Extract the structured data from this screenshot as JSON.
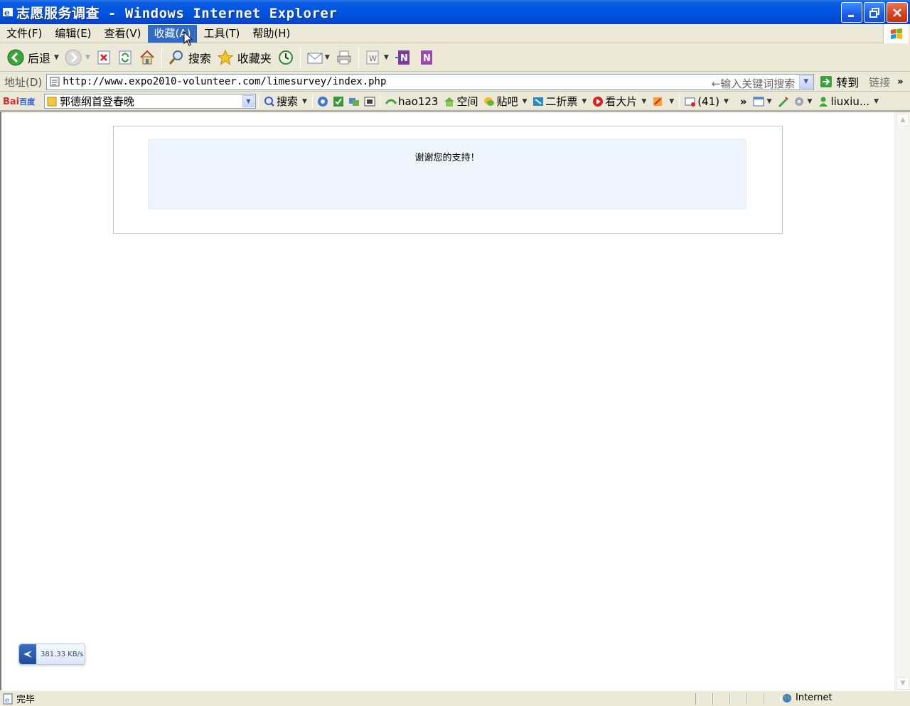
{
  "window": {
    "title": "志愿服务调查 - Windows Internet Explorer"
  },
  "menu": {
    "items": [
      "文件(F)",
      "编辑(E)",
      "查看(V)",
      "收藏(A)",
      "工具(T)",
      "帮助(H)"
    ],
    "active_index": 3
  },
  "toolbar": {
    "back_label": "后退",
    "search_label": "搜索",
    "favorites_label": "收藏夹"
  },
  "address": {
    "label": "地址(D)",
    "url": "http://www.expo2010-volunteer.com/limesurvey/index.php",
    "hint": "←输入关键词搜索",
    "go_label": "转到",
    "links_label": "链接",
    "more_label": "»"
  },
  "baidu_bar": {
    "logo_bai": "Bai",
    "logo_du": "百度",
    "query": "郭德纲首登春晚",
    "search_label": "搜索",
    "hao123_label": "hao123",
    "space_label": "空间",
    "tieba_label": "贴吧",
    "discount_label": "二折票",
    "movie_label": "看大片",
    "mail_count": "(41)",
    "more_label": "»",
    "user_label": "liuxiu..."
  },
  "page": {
    "message": "谢谢您的支持！"
  },
  "speed_widget": {
    "value": "381.33 KB/s"
  },
  "status": {
    "text": "完毕",
    "zone": "Internet"
  },
  "colors": {
    "titlebar": "#0054e3",
    "menu_highlight": "#316ac5",
    "panel_bg": "#eff5fd",
    "frame_border": "#b6c8cf"
  }
}
